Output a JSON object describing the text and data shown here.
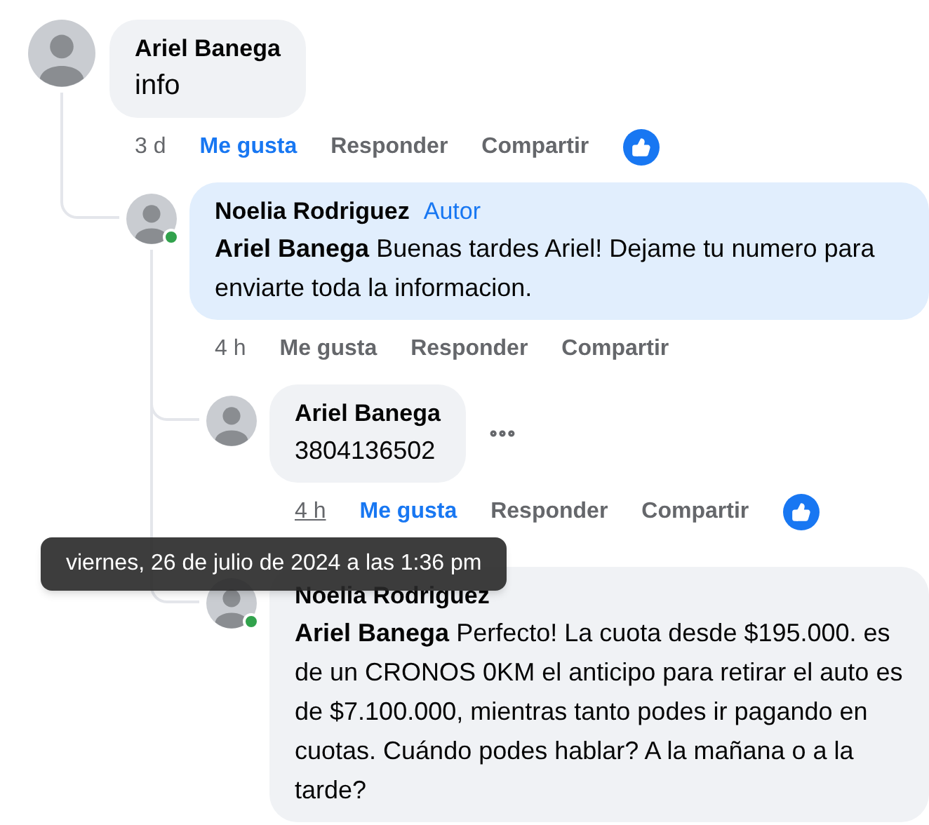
{
  "thread": [
    {
      "author": "Ariel Banega",
      "text": "info",
      "time": "3 d",
      "time_hovered": false,
      "liked": true,
      "has_reaction": true,
      "actions": {
        "like": "Me gusta",
        "reply": "Responder",
        "share": "Compartir"
      },
      "children": [
        {
          "author": "Noelia Rodriguez",
          "badge": "Autor",
          "mention": "Ariel Banega",
          "text": "Buenas tardes Ariel! Dejame tu numero para enviarte toda la informacion.",
          "online": true,
          "highlighted": true,
          "time": "4 h",
          "time_hovered": false,
          "liked": false,
          "actions": {
            "like": "Me gusta",
            "reply": "Responder",
            "share": "Compartir"
          },
          "children": [
            {
              "author": "Ariel Banega",
              "text": "3804136502",
              "more_button": true,
              "time": "4 h",
              "time_hovered": true,
              "liked": true,
              "has_reaction": true,
              "actions": {
                "like": "Me gusta",
                "reply": "Responder",
                "share": "Compartir"
              }
            },
            {
              "author": "Noelia Rodriguez",
              "mention": "Ariel Banega",
              "text": "Perfecto! La cuota desde $195.000. es de un CRONOS 0KM el anticipo para retirar el auto es de $7.100.000, mientras tanto podes ir pagando en cuotas. Cuándo podes hablar? A la mañana o a la tarde?",
              "online": true
            }
          ]
        }
      ]
    }
  ],
  "tooltip": {
    "text": "viernes, 26 de julio de 2024 a las 1:36 pm"
  }
}
